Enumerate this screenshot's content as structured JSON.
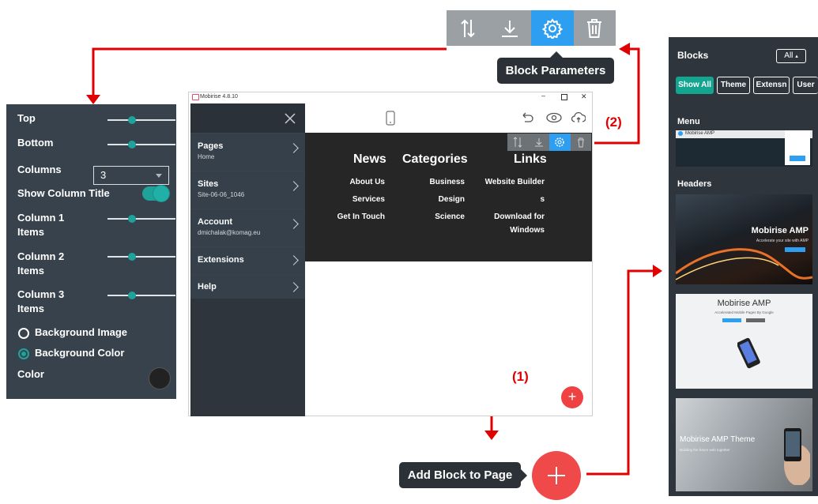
{
  "toolbar": {
    "tooltip": "Block Parameters",
    "icons": [
      "sort-icon",
      "download-icon",
      "gear-icon",
      "trash-icon"
    ]
  },
  "params": {
    "top": "Top",
    "bottom": "Bottom",
    "columns": "Columns",
    "columns_value": "3",
    "show_column_title": "Show Column Title",
    "show_column_title_on": true,
    "column1_items": [
      "Column 1",
      "Items"
    ],
    "column2_items": [
      "Column 2",
      "Items"
    ],
    "column3_items": [
      "Column 3",
      "Items"
    ],
    "background_image": "Background Image",
    "background_color": "Background Color",
    "color": "Color"
  },
  "window": {
    "title": "Mobirise 4.8.10",
    "sidebar": [
      {
        "label": "Pages",
        "sub": "Home"
      },
      {
        "label": "Sites",
        "sub": "Site-06-06_1046"
      },
      {
        "label": "Account",
        "sub": "dmichalak@komag.eu"
      },
      {
        "label": "Extensions",
        "sub": ""
      },
      {
        "label": "Help",
        "sub": ""
      }
    ],
    "footer": {
      "columns": [
        {
          "heading": "News",
          "items": [
            "About Us",
            "Services",
            "Get In Touch"
          ]
        },
        {
          "heading": "Categories",
          "items": [
            "Business",
            "Design",
            "Science"
          ]
        },
        {
          "heading": "Links",
          "items": [
            "Website Builder",
            "s",
            "Download for",
            "Windows"
          ]
        }
      ]
    },
    "add_small": "+"
  },
  "annotations": {
    "one": "(1)",
    "two": "(2)",
    "add_tooltip": "Add Block to Page"
  },
  "blocks_panel": {
    "title": "Blocks",
    "all": "All",
    "chips": [
      "Show All",
      "Theme",
      "Extensn",
      "User"
    ],
    "menu": "Menu",
    "headers": "Headers",
    "menu_thumb_text": "Mobirise AMP",
    "thumb1": {
      "title": "Mobirise AMP",
      "sub": "Accelerate your site with AMP"
    },
    "thumb2": {
      "title": "Mobirise AMP",
      "sub": "Accelerated Mobile Pages By Google"
    },
    "thumb3": {
      "title": "Mobirise AMP Theme",
      "sub": "Building the future web together"
    }
  },
  "colors": {
    "accent": "#2e9ef0",
    "teal": "#1ea29a",
    "red": "#e10000",
    "add": "#f04949",
    "panel": "#37424c"
  }
}
